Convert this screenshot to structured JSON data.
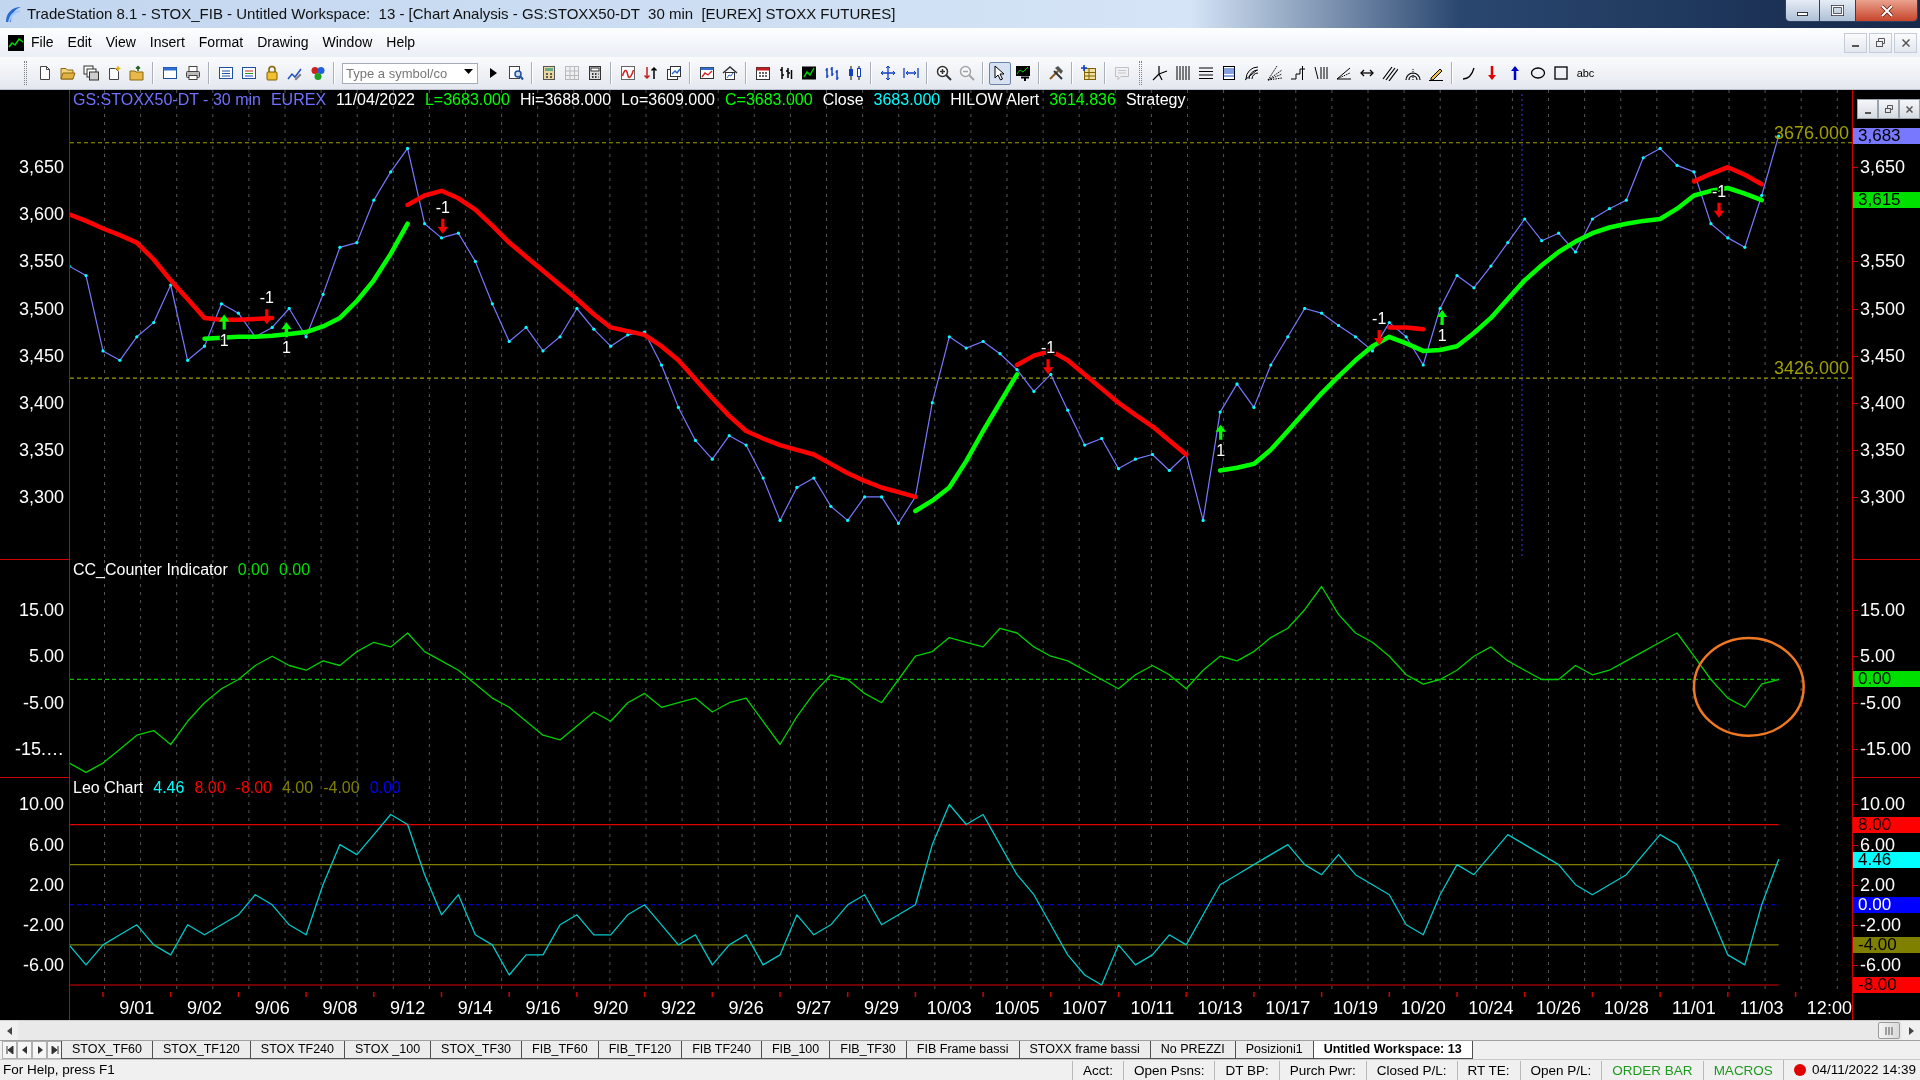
{
  "window": {
    "title": "TradeStation 8.1 - STOX_FIB - Untitled Workspace:  13 - [Chart Analysis - GS:STOXX50-DT  30 min  [EUREX] STOXX FUTURES]"
  },
  "menu": [
    "File",
    "Edit",
    "View",
    "Insert",
    "Format",
    "Drawing",
    "Window",
    "Help"
  ],
  "toolbar": {
    "groups": [
      [
        {
          "kind": "new-document",
          "disabled": false
        },
        {
          "kind": "open-folder",
          "disabled": false
        },
        {
          "kind": "stacked-windows",
          "disabled": false
        },
        {
          "kind": "document-sparkle",
          "disabled": false
        },
        {
          "kind": "folder-arrow",
          "disabled": false
        }
      ],
      [
        {
          "kind": "window",
          "disabled": false
        },
        {
          "kind": "printer",
          "disabled": false
        }
      ],
      [
        {
          "kind": "list-window",
          "disabled": false
        },
        {
          "kind": "list-window-lines",
          "disabled": false
        },
        {
          "kind": "lock",
          "disabled": false
        },
        {
          "kind": "chart-pen",
          "disabled": false
        },
        {
          "kind": "dots-cluster",
          "disabled": false
        }
      ],
      [
        {
          "kind": "symbol-field",
          "placeholder": "Type a symbol/co"
        },
        {
          "kind": "play",
          "disabled": false
        },
        {
          "kind": "search-document",
          "disabled": false
        }
      ],
      [
        {
          "kind": "calculator-money",
          "disabled": false
        },
        {
          "kind": "grid",
          "disabled": true
        },
        {
          "kind": "calculator",
          "disabled": false
        }
      ],
      [
        {
          "kind": "chart-wave",
          "disabled": false
        },
        {
          "kind": "sort-arrows",
          "disabled": false
        },
        {
          "kind": "windows-chart",
          "disabled": false
        }
      ],
      [
        {
          "kind": "chart-window",
          "disabled": false
        },
        {
          "kind": "house-chart",
          "disabled": false
        }
      ],
      [
        {
          "kind": "calendar",
          "disabled": false
        },
        {
          "kind": "bar-chart",
          "disabled": false
        },
        {
          "kind": "chart-screen",
          "disabled": false
        },
        {
          "kind": "price-bars",
          "disabled": false
        },
        {
          "kind": "candles",
          "disabled": false
        }
      ],
      [
        {
          "kind": "cross-arrows",
          "disabled": false
        },
        {
          "kind": "width-arrows",
          "disabled": false
        }
      ],
      [
        {
          "kind": "zoom-in",
          "disabled": false
        },
        {
          "kind": "zoom-out",
          "disabled": true
        }
      ],
      [
        {
          "kind": "pointer",
          "selected": true,
          "disabled": false
        },
        {
          "kind": "chart-text",
          "selected": false,
          "disabled": false
        }
      ],
      [
        {
          "kind": "hammer-wrench",
          "disabled": false
        }
      ],
      [
        {
          "kind": "table-plus",
          "disabled": false
        }
      ],
      [
        {
          "kind": "speech-bubble",
          "disabled": true
        }
      ],
      [
        {
          "kind": "pitchfork",
          "selected": false,
          "disabled": false
        },
        {
          "kind": "vertical-lines",
          "selected": false,
          "disabled": false
        },
        {
          "kind": "horizontal-lines",
          "selected": false,
          "disabled": false
        },
        {
          "kind": "levels",
          "selected": false,
          "disabled": false
        },
        {
          "kind": "speed-arcs",
          "selected": false,
          "disabled": false
        },
        {
          "kind": "fan-lines",
          "selected": false,
          "disabled": false
        },
        {
          "kind": "steps",
          "selected": false,
          "disabled": false
        },
        {
          "kind": "slanted-lines",
          "selected": false,
          "disabled": false
        },
        {
          "kind": "angle",
          "selected": false,
          "disabled": false
        },
        {
          "kind": "double-arrow",
          "selected": false,
          "disabled": false
        },
        {
          "kind": "parallel-lines",
          "selected": false,
          "disabled": false
        },
        {
          "kind": "semicircles",
          "selected": false,
          "disabled": false
        },
        {
          "kind": "pencil",
          "selected": false,
          "disabled": false
        }
      ],
      [
        {
          "kind": "curve",
          "selected": false,
          "disabled": false
        },
        {
          "kind": "down-arrow",
          "selected": false,
          "disabled": false
        },
        {
          "kind": "up-arrow",
          "selected": false,
          "disabled": false
        },
        {
          "kind": "ellipse",
          "selected": false,
          "disabled": false
        },
        {
          "kind": "rectangle",
          "selected": false,
          "disabled": false
        },
        {
          "kind": "text",
          "label": "abc",
          "selected": false,
          "disabled": false
        }
      ]
    ]
  },
  "chart": {
    "panes": [
      {
        "kind": "price",
        "header": [
          {
            "text": "GS:STOXX50-DT - 30 min",
            "color": "#7070ff"
          },
          {
            "text": "EUREX",
            "color": "#7070ff"
          },
          {
            "text": "11/04/2022",
            "color": "#ffffff"
          },
          {
            "text": "L=3683.000",
            "color": "#00ff00"
          },
          {
            "text": "Hi=3688.000",
            "color": "#ffffff"
          },
          {
            "text": "Lo=3609.000",
            "color": "#ffffff"
          },
          {
            "text": "C=3683.000",
            "color": "#00ff00"
          },
          {
            "text": "Close",
            "color": "#ffffff"
          },
          {
            "text": "3683.000",
            "color": "#00ffff"
          },
          {
            "text": "HILOW Alert",
            "color": "#ffffff"
          },
          {
            "text": "3614.836",
            "color": "#00ff00"
          },
          {
            "text": "Strategy",
            "color": "#ffffff"
          }
        ],
        "left_axis": [
          "3,650",
          "3,600",
          "3,550",
          "3,500",
          "3,450",
          "3,400",
          "3,350",
          "3,300"
        ],
        "badges": [
          {
            "text": "3,683",
            "color": "#7878ff"
          },
          {
            "text": "3,615",
            "color": "#00e000"
          }
        ],
        "signals": [
          {
            "kind": "buy"
          },
          {
            "kind": "sell"
          },
          {
            "kind": "buy"
          },
          {
            "kind": "sell"
          },
          {
            "kind": "sell"
          },
          {
            "kind": "buy"
          },
          {
            "kind": "sell"
          },
          {
            "kind": "buy"
          },
          {
            "kind": "sell"
          }
        ],
        "chart_data": {
          "type": "line",
          "grid": true,
          "categories": [
            null,
            null,
            null,
            null,
            null,
            null,
            null,
            null,
            null,
            null,
            null,
            null,
            null,
            null,
            null,
            null,
            null,
            null,
            null,
            null,
            null,
            null,
            null,
            null,
            null,
            null,
            null,
            null,
            null,
            null,
            null,
            null,
            null,
            null,
            null,
            null,
            null,
            null,
            null,
            null,
            null,
            null,
            null,
            null,
            null,
            null,
            null,
            null,
            null,
            null,
            null,
            null,
            null,
            null,
            null,
            null,
            null,
            null,
            null,
            null,
            null,
            null,
            null,
            null,
            null,
            null,
            null,
            null,
            null,
            null,
            null,
            null,
            null,
            null,
            null,
            null,
            null,
            null,
            null,
            null,
            null,
            null,
            null,
            null,
            null,
            null,
            null,
            null,
            null,
            null,
            null,
            null,
            null,
            null,
            null,
            null,
            null,
            null,
            null,
            null,
            null,
            null,
            null,
            null,
            null
          ],
          "series": [
            {
              "color": "#7878ff",
              "values": [
                3545,
                3535,
                3455,
                3445,
                3470,
                3485,
                3525,
                3445,
                3460,
                3505,
                3495,
                3470,
                3480,
                3500,
                3470,
                3515,
                3565,
                3570,
                3615,
                3645,
                3670,
                3590,
                3575,
                3580,
                3550,
                3505,
                3465,
                3480,
                3455,
                3470,
                3500,
                3478,
                3460,
                3472,
                3475,
                3440,
                3395,
                3360,
                3340,
                3365,
                3355,
                3320,
                3275,
                3310,
                3320,
                3290,
                3275,
                3300,
                3300,
                3272,
                3300,
                3400,
                3470,
                3458,
                3465,
                3452,
                3435,
                3412,
                3430,
                3392,
                3355,
                3362,
                3330,
                3340,
                3345,
                3328,
                3345,
                3275,
                3390,
                3420,
                3395,
                3440,
                3470,
                3500,
                3495,
                3482,
                3470,
                3455,
                3485,
                3470,
                3440,
                3500,
                3535,
                3522,
                3545,
                3570,
                3595,
                3572,
                3580,
                3560,
                3595,
                3606,
                3615,
                3660,
                3670,
                3652,
                3645,
                3590,
                3575,
                3565,
                3620,
                3683,
                null,
                null,
                null
              ]
            },
            {
              "color": "#ff0000",
              "values": [
                3600,
                3593,
                3585,
                3578,
                3570,
                3552,
                3530,
                3510,
                3490,
                3488,
                3488,
                3489,
                3490,
                null,
                null,
                null,
                null,
                null,
                null,
                null,
                3610,
                3620,
                3625,
                3617,
                3605,
                3588,
                3570,
                3555,
                3540,
                3525,
                3510,
                3494,
                3480,
                3476,
                3472,
                3460,
                3445,
                3425,
                3405,
                3386,
                3370,
                3362,
                3355,
                3350,
                3345,
                3335,
                3325,
                3317,
                3310,
                3305,
                3300,
                null,
                null,
                null,
                null,
                null,
                3440,
                3450,
                3455,
                3445,
                3430,
                3415,
                3400,
                3387,
                3375,
                3360,
                3345,
                null,
                null,
                null,
                null,
                null,
                null,
                null,
                null,
                null,
                null,
                null,
                3480,
                3480,
                3478,
                null,
                null,
                null,
                null,
                null,
                null,
                null,
                null,
                null,
                null,
                null,
                null,
                null,
                null,
                null,
                3635,
                3643,
                3650,
                3642,
                3632,
                null,
                null,
                null,
                null
              ]
            },
            {
              "color": "#00ff00",
              "values": [
                null,
                null,
                null,
                null,
                null,
                null,
                null,
                null,
                3468,
                3469,
                3470,
                3470,
                3471,
                3473,
                3475,
                3481,
                3490,
                3508,
                3530,
                3558,
                3590,
                null,
                null,
                null,
                null,
                null,
                null,
                null,
                null,
                null,
                null,
                null,
                null,
                null,
                null,
                null,
                null,
                null,
                null,
                null,
                null,
                null,
                null,
                null,
                null,
                null,
                null,
                null,
                null,
                null,
                3285,
                3296,
                3310,
                3338,
                3370,
                3400,
                3430,
                null,
                null,
                null,
                null,
                null,
                null,
                null,
                null,
                null,
                null,
                null,
                3328,
                3331,
                3335,
                3350,
                3370,
                3390,
                3410,
                3428,
                3445,
                3460,
                3470,
                3463,
                3455,
                3456,
                3460,
                3474,
                3490,
                3510,
                3530,
                3546,
                3560,
                3571,
                3580,
                3586,
                3590,
                3593,
                3595,
                3606,
                3620,
                3625,
                3628,
                3622,
                3615,
                null,
                null,
                null,
                null
              ]
            }
          ],
          "ylim": [
            3233,
            3732
          ],
          "yticks": [
            {
              "value": 3650,
              "label": "3,650"
            },
            {
              "value": 3550,
              "label": "3,550"
            },
            {
              "value": 3500,
              "label": "3,500"
            },
            {
              "value": 3450,
              "label": "3,450"
            },
            {
              "value": 3400,
              "label": "3,400"
            },
            {
              "value": 3350,
              "label": "3,350"
            },
            {
              "value": 3300,
              "label": "3,300"
            }
          ],
          "ref_lines": [
            {
              "axis": "y",
              "value": 3676,
              "label": "3676.000",
              "color": "#a0a000"
            },
            {
              "axis": "y",
              "value": 3426,
              "label": "3426.000",
              "color": "#a0a000"
            }
          ],
          "annotations": [
            "1",
            "-1",
            "1",
            "-1",
            "-1",
            "1",
            "-1",
            "1",
            "-1"
          ]
        }
      },
      {
        "kind": "indicator",
        "header": [
          {
            "text": "CC_Counter Indicator",
            "color": "#ffffff"
          },
          {
            "text": "0.00",
            "color": "#00e000"
          },
          {
            "text": "0.00",
            "color": "#00e000"
          }
        ],
        "left_axis": [
          "15.00",
          "5.00",
          "-5.00",
          "-15.…"
        ],
        "badges": [
          {
            "text": "0.00",
            "color": "#00e000"
          }
        ],
        "drawings": [
          {
            "kind": "ellipse",
            "color": "#f07820"
          }
        ],
        "chart_data": {
          "type": "line",
          "grid": true,
          "categories": [
            null,
            null,
            null,
            null,
            null,
            null,
            null,
            null,
            null,
            null,
            null,
            null,
            null,
            null,
            null,
            null,
            null,
            null,
            null,
            null,
            null,
            null,
            null,
            null,
            null,
            null,
            null,
            null,
            null,
            null,
            null,
            null,
            null,
            null,
            null,
            null,
            null,
            null,
            null,
            null,
            null,
            null,
            null,
            null,
            null,
            null,
            null,
            null,
            null,
            null,
            null,
            null,
            null,
            null,
            null,
            null,
            null,
            null,
            null,
            null,
            null,
            null,
            null,
            null,
            null,
            null,
            null,
            null,
            null,
            null,
            null,
            null,
            null,
            null,
            null,
            null,
            null,
            null,
            null,
            null,
            null,
            null,
            null,
            null,
            null,
            null,
            null,
            null,
            null,
            null,
            null,
            null,
            null,
            null,
            null,
            null,
            null,
            null,
            null,
            null,
            null,
            null,
            null,
            null,
            null
          ],
          "series": [
            {
              "color": "#00d000",
              "values": [
                -18,
                -20,
                -18,
                -15,
                -12,
                -11,
                -14,
                -9,
                -5,
                -2,
                0,
                3,
                5,
                3,
                2,
                4,
                3,
                6,
                8,
                7,
                10,
                6,
                4,
                2,
                -1,
                -4,
                -6,
                -9,
                -12,
                -13,
                -10,
                -7,
                -9,
                -5,
                -3,
                -6,
                -5,
                -4,
                -7,
                -5,
                -4,
                -9,
                -14,
                -8,
                -3,
                1,
                0,
                -3,
                -5,
                0,
                5,
                6,
                9,
                8,
                7,
                11,
                10,
                7,
                5,
                4,
                2,
                0,
                -2,
                1,
                3,
                1,
                -2,
                2,
                5,
                4,
                6,
                9,
                11,
                15,
                20,
                14,
                10,
                8,
                5,
                1,
                -1,
                0,
                2,
                5,
                7,
                4,
                2,
                0,
                0,
                3,
                1,
                2,
                4,
                6,
                8,
                10,
                5,
                0,
                -4,
                -6,
                -1,
                0,
                null,
                null,
                null
              ]
            }
          ],
          "ylim": [
            -21.2,
            25.7
          ],
          "yticks": [
            {
              "value": 15,
              "label": "15.00"
            },
            {
              "value": 5,
              "label": "5.00"
            },
            {
              "value": -5,
              "label": "-5.00"
            },
            {
              "value": -15,
              "label": "-15.00"
            }
          ],
          "ref_lines": [
            {
              "axis": "y",
              "value": 0,
              "color": "#00c000"
            }
          ]
        }
      },
      {
        "kind": "indicator",
        "header": [
          {
            "text": "Leo Chart",
            "color": "#ffffff"
          },
          {
            "text": "4.46",
            "color": "#00ffff"
          },
          {
            "text": "8.00",
            "color": "#ff0000"
          },
          {
            "text": "-8.00",
            "color": "#ff0000"
          },
          {
            "text": "4.00",
            "color": "#808000"
          },
          {
            "text": "-4.00",
            "color": "#808000"
          },
          {
            "text": "0.00",
            "color": "#0000ff"
          }
        ],
        "left_axis": [
          "10.00",
          "6.00",
          "2.00",
          "-2.00",
          "-6.00"
        ],
        "badges": [
          {
            "text": "8.00",
            "color": "#ff0000"
          },
          {
            "text": "4.46",
            "color": "#00ffff"
          },
          {
            "text": "0.00",
            "color": "#0000ff"
          },
          {
            "text": "-4.00",
            "color": "#808000"
          },
          {
            "text": "-8.00",
            "color": "#ff0000"
          }
        ],
        "chart_data": {
          "type": "line",
          "grid": true,
          "categories": [
            null,
            null,
            null,
            null,
            "9/01",
            null,
            null,
            null,
            "9/02",
            null,
            null,
            null,
            "9/06",
            null,
            null,
            null,
            "9/08",
            null,
            null,
            null,
            "9/12",
            null,
            null,
            null,
            "9/14",
            null,
            null,
            null,
            "9/16",
            null,
            null,
            null,
            "9/20",
            null,
            null,
            null,
            "9/22",
            null,
            null,
            null,
            "9/26",
            null,
            null,
            null,
            "9/27",
            null,
            null,
            null,
            "9/29",
            null,
            null,
            null,
            "10/03",
            null,
            null,
            null,
            "10/05",
            null,
            null,
            null,
            "10/07",
            null,
            null,
            null,
            "10/11",
            null,
            null,
            null,
            "10/13",
            null,
            null,
            null,
            "10/17",
            null,
            null,
            null,
            "10/19",
            null,
            null,
            null,
            "10/20",
            null,
            null,
            null,
            "10/24",
            null,
            null,
            null,
            "10/26",
            null,
            null,
            null,
            "10/28",
            null,
            null,
            null,
            "11/01",
            null,
            null,
            null,
            "11/03",
            null,
            null,
            null,
            "12:00"
          ],
          "series": [
            {
              "color": "#00c8c8",
              "values": [
                -4,
                -6,
                -4,
                -3,
                -2,
                -4,
                -5,
                -2,
                -3,
                -2,
                -1,
                1,
                0,
                -2,
                -3,
                2,
                6,
                5,
                7,
                9,
                8,
                3,
                -1,
                1,
                -3,
                -4,
                -7,
                -5,
                -5,
                -2,
                -1,
                -3,
                -3,
                -1,
                0,
                -2,
                -4,
                -3,
                -6,
                -4,
                -3,
                -6,
                -5,
                -1,
                -3,
                -2,
                0,
                1,
                -2,
                -1,
                0,
                6,
                10,
                8,
                9,
                6,
                3,
                1,
                -2,
                -5,
                -7,
                -8,
                -4,
                -6,
                -5,
                -3,
                -4,
                -1,
                2,
                3,
                4,
                5,
                6,
                4,
                3,
                5,
                3,
                2,
                1,
                -2,
                -3,
                1,
                4,
                3,
                5,
                7,
                6,
                5,
                4,
                2,
                1,
                2,
                3,
                5,
                7,
                6,
                3,
                -1,
                -5,
                -6,
                0,
                4.5,
                null,
                null,
                null
              ]
            }
          ],
          "ylim": [
            -8.7,
            12.64
          ],
          "yticks": [
            {
              "value": 10,
              "label": "10.00"
            },
            {
              "value": 6,
              "label": "6.00"
            },
            {
              "value": 2,
              "label": "2.00"
            },
            {
              "value": -2,
              "label": "-2.00"
            },
            {
              "value": -6,
              "label": "-6.00"
            }
          ],
          "ref_lines": [
            {
              "axis": "y",
              "value": 8,
              "color": "#e00000"
            },
            {
              "axis": "y",
              "value": 4,
              "color": "#808000"
            },
            {
              "axis": "y",
              "value": 0,
              "color": "#0000ff"
            },
            {
              "axis": "y",
              "value": -4,
              "color": "#808000"
            },
            {
              "axis": "y",
              "value": -8,
              "color": "#e00000"
            }
          ]
        }
      }
    ]
  },
  "workspace_tabs": [
    {
      "label": "STOX_TF60",
      "selected": false
    },
    {
      "label": "STOX_TF120",
      "selected": false
    },
    {
      "label": "STOX TF240",
      "selected": false
    },
    {
      "label": "STOX _100",
      "selected": false
    },
    {
      "label": "STOX_TF30",
      "selected": false
    },
    {
      "label": "FIB_TF60",
      "selected": false
    },
    {
      "label": "FIB_TF120",
      "selected": false
    },
    {
      "label": "FIB TF240",
      "selected": false
    },
    {
      "label": "FIB_100",
      "selected": false
    },
    {
      "label": "FIB_TF30",
      "selected": false
    },
    {
      "label": "FIB Frame bassi",
      "selected": false
    },
    {
      "label": "STOXX frame bassi",
      "selected": false
    },
    {
      "label": "No PREZZI",
      "selected": false
    },
    {
      "label": "Posizioni1",
      "selected": false
    },
    {
      "label": "Untitled Workspace: 13",
      "selected": true
    }
  ],
  "status_bar": {
    "help": "For Help, press F1",
    "panels": [
      {
        "text": "Acct:",
        "color": "#000000"
      },
      {
        "text": "Open Psns:",
        "color": "#000000"
      },
      {
        "text": "DT BP:",
        "color": "#000000"
      },
      {
        "text": "Purch Pwr:",
        "color": "#000000"
      },
      {
        "text": "Closed P/L:",
        "color": "#000000"
      },
      {
        "text": "RT TE:",
        "color": "#000000"
      },
      {
        "text": "Open P/L:",
        "color": "#000000"
      },
      {
        "text": "ORDER BAR",
        "color": "#1e9a1e"
      },
      {
        "text": "MACROS",
        "color": "#1e9a1e"
      }
    ],
    "connection": {
      "color": "#e00000"
    },
    "clock": "04/11/2022 14:39"
  }
}
